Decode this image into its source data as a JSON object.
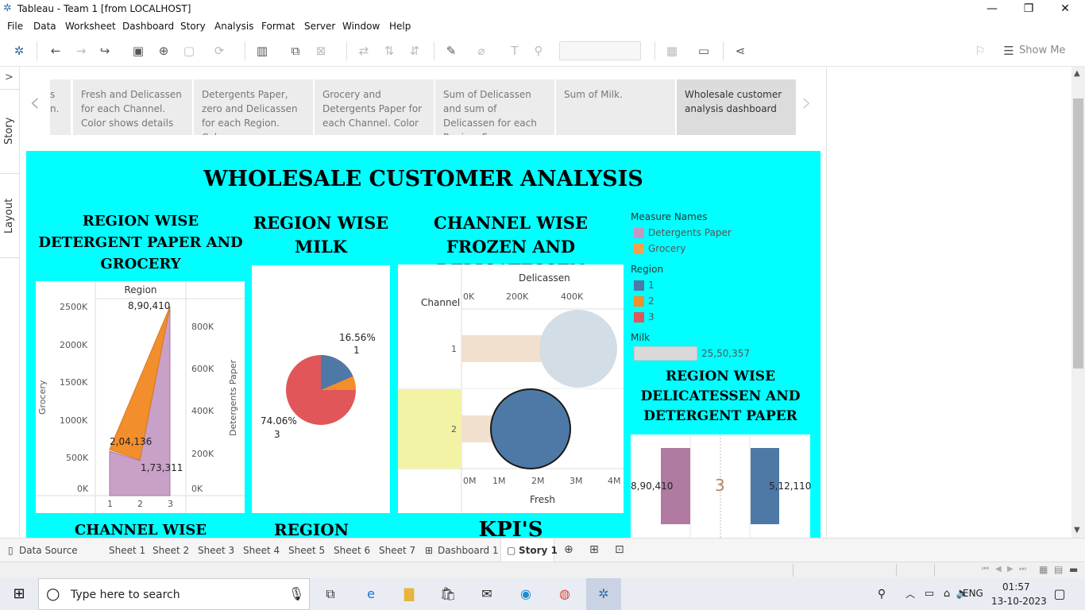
{
  "window": {
    "title": "Tableau - Team 1 [from LOCALHOST]",
    "minimize": "—",
    "restore": "❐",
    "close": "✕"
  },
  "menu": [
    "File",
    "Data",
    "Worksheet",
    "Dashboard",
    "Story",
    "Analysis",
    "Format",
    "Server",
    "Window",
    "Help"
  ],
  "toolbar": {
    "show_me": "Show Me"
  },
  "left_rail": {
    "expand": ">",
    "story": "Story",
    "layout": "Layout"
  },
  "story_points": [
    "s\nn.",
    "Fresh and Delicassen for each Channel. Color shows details",
    "Detergents Paper, zero and Delicassen for each Region. Color",
    "Grocery and Detergents Paper for each Channel. Color",
    "Sum of Delicassen and sum of Delicassen for each Region. For pane",
    "Sum of Milk.",
    "Wholesale customer analysis dashboard"
  ],
  "dashboard": {
    "title": "WHOLESALE CUSTOMER ANALYSIS",
    "h1": "REGION WISE DETERGENT PAPER AND GROCERY",
    "h2": "REGION WISE MILK",
    "h3": "CHANNEL WISE FROZEN AND DELICATESSEN",
    "h4": "REGION WISE DELICATESSEN AND DETERGENT PAPER",
    "h5": "CHANNEL WISE",
    "h6": "REGION WISE",
    "h7": "KPI'S"
  },
  "chart1": {
    "header": "Region",
    "y_left_label": "Grocery",
    "y_right_label": "Detergents Paper",
    "y_left_ticks": [
      "2500K",
      "2000K",
      "1500K",
      "1000K",
      "500K",
      "0K"
    ],
    "y_right_ticks": [
      "800K",
      "600K",
      "400K",
      "200K",
      "0K"
    ],
    "x_ticks": [
      "1",
      "2",
      "3"
    ],
    "labels": [
      "8,90,410",
      "2,04,136",
      "1,73,311"
    ]
  },
  "chart2": {
    "labels": [
      {
        "pct": "16.56%",
        "region": "1"
      },
      {
        "pct": "74.06%",
        "region": "3"
      }
    ]
  },
  "chart3": {
    "top_axis_label": "Delicassen",
    "top_ticks": [
      "0K",
      "200K",
      "400K"
    ],
    "row_header": "Channel",
    "rows": [
      "1",
      "2"
    ],
    "bottom_ticks": [
      "0M",
      "1M",
      "2M",
      "3M",
      "4M"
    ],
    "bottom_label": "Fresh"
  },
  "legend": {
    "measure_title": "Measure Names",
    "measures": [
      {
        "name": "Detergents Paper",
        "color": "#c795c2"
      },
      {
        "name": "Grocery",
        "color": "#f5a04a"
      }
    ],
    "region_title": "Region",
    "regions": [
      {
        "name": "1",
        "color": "#4e79a7"
      },
      {
        "name": "2",
        "color": "#f28e2b"
      },
      {
        "name": "3",
        "color": "#e15759"
      }
    ],
    "milk_title": "Milk",
    "milk_value": "25,50,357"
  },
  "chart4": {
    "left_value": "8,90,410",
    "center": "3",
    "right_value": "5,12,110"
  },
  "sheets": [
    "Data Source",
    "Sheet 1",
    "Sheet 2",
    "Sheet 3",
    "Sheet 4",
    "Sheet 5",
    "Sheet 6",
    "Sheet 7",
    "Dashboard 1",
    "Story 1"
  ],
  "taskbar": {
    "search_placeholder": "Type here to search",
    "lang": "ENG",
    "time": "01:57",
    "date": "13-10-2023"
  },
  "chart_data": {
    "type": "area",
    "title": "REGION WISE DETERGENT PAPER AND GROCERY",
    "categories": [
      "1",
      "2",
      "3"
    ],
    "series": [
      {
        "name": "Grocery",
        "values": [
          570000,
          420000,
          2500000
        ]
      },
      {
        "name": "Detergents Paper",
        "values": [
          204136,
          173311,
          890410
        ]
      }
    ]
  }
}
